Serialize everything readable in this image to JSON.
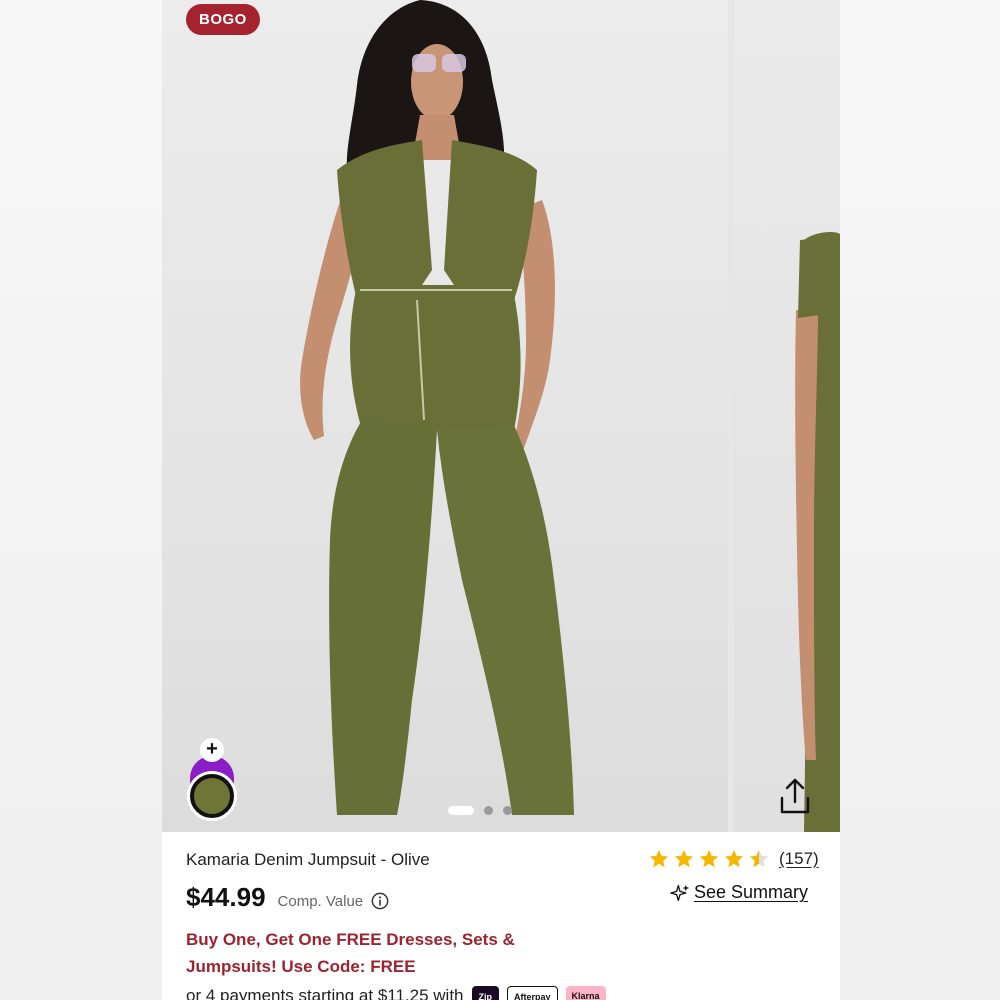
{
  "badge": "BOGO",
  "product": {
    "title": "Kamaria Denim Jumpsuit - Olive",
    "price": "$44.99",
    "comp_value_label": "Comp. Value",
    "rating": 4.5,
    "review_count": "(157)",
    "see_summary_label": "See Summary",
    "promo_text": "Buy One, Get One FREE Dresses, Sets & Jumpsuits! Use Code: FREE",
    "payments_text": "or 4 payments starting at $11.25 with",
    "payment_logos": [
      "Zip",
      "Afterpay",
      "Klarna"
    ]
  },
  "swatches": {
    "plus_label": "+",
    "colors": [
      "#8a1fc9",
      "#6f7536"
    ],
    "selected": "Olive"
  },
  "gallery": {
    "current_slide": 1,
    "total_dots": 3
  },
  "colors": {
    "badge_bg": "#a4232f",
    "promo_text": "#9c2430",
    "star": "#f5b800",
    "olive": "#6f7536"
  },
  "icons": [
    "share-icon",
    "info-icon",
    "sparkle-icon",
    "star-icon",
    "star-half-icon"
  ]
}
